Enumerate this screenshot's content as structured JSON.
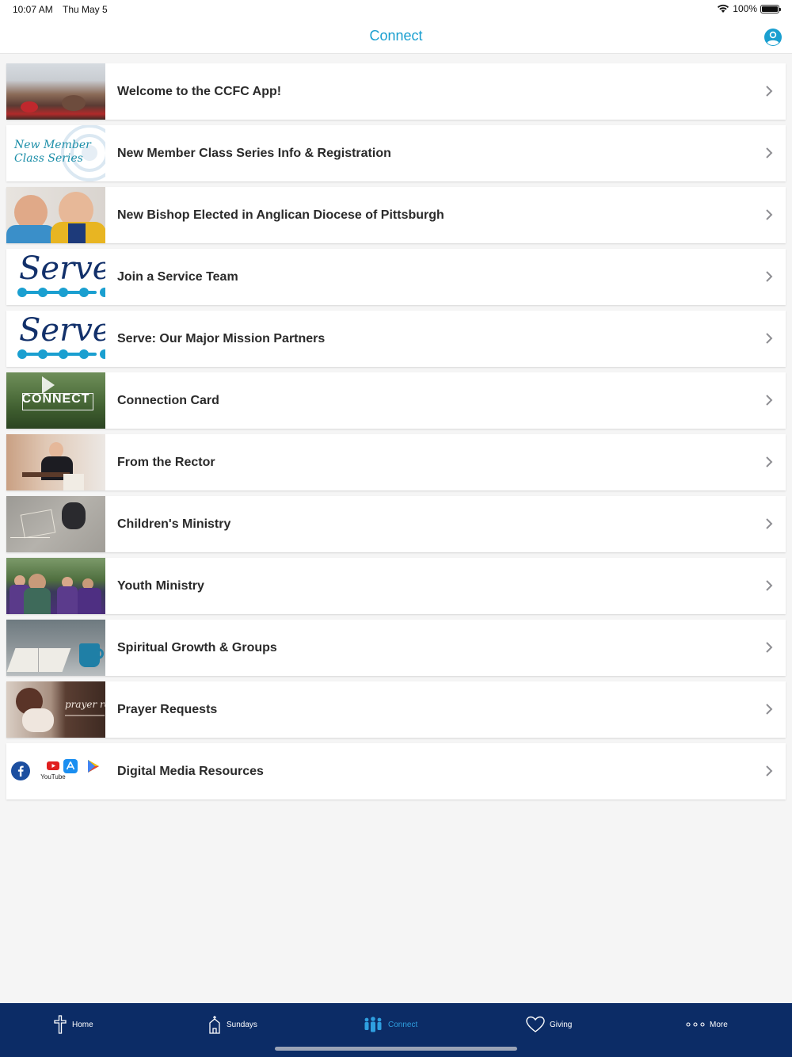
{
  "status_bar": {
    "time": "10:07 AM",
    "date": "Thu May 5",
    "battery": "100%",
    "battery_level": 1.0
  },
  "nav": {
    "title": "Connect",
    "profile_icon": "person-circle-icon"
  },
  "items": [
    {
      "label": "Welcome to the CCFC App!"
    },
    {
      "label": "New Member Class Series Info & Registration",
      "thumb_text_1": "New Member",
      "thumb_text_2": "Class Series"
    },
    {
      "label": "New Bishop Elected in Anglican Diocese of Pittsburgh"
    },
    {
      "label": "Join a Service Team",
      "thumb_text": "Serve"
    },
    {
      "label": "Serve: Our Major Mission Partners",
      "thumb_text": "Serve"
    },
    {
      "label": "Connection Card",
      "thumb_text": "CONNECT"
    },
    {
      "label": "From the Rector"
    },
    {
      "label": "Children's Ministry"
    },
    {
      "label": "Youth Ministry"
    },
    {
      "label": "Spiritual Growth & Groups"
    },
    {
      "label": "Prayer Requests",
      "thumb_text": "prayer req"
    },
    {
      "label": "Digital Media Resources",
      "thumb_text_youtube": "YouTube"
    }
  ],
  "tabs": [
    {
      "label": "Home",
      "icon": "cross-icon"
    },
    {
      "label": "Sundays",
      "icon": "church-icon"
    },
    {
      "label": "Connect",
      "icon": "people-icon",
      "active": true
    },
    {
      "label": "Giving",
      "icon": "heart-icon"
    },
    {
      "label": "More",
      "icon": "more-dots-icon"
    }
  ],
  "colors": {
    "accent": "#1a9fd0",
    "tab_bar": "#0c2c66",
    "tab_active": "#2f9fe0"
  }
}
